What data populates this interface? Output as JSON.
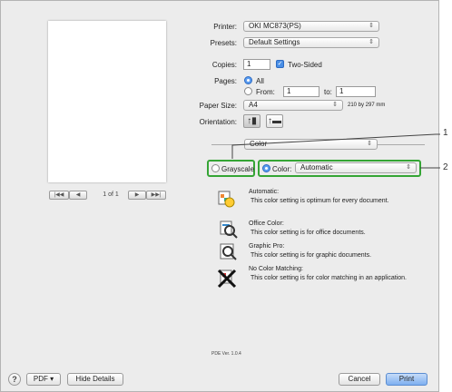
{
  "printer": {
    "label": "Printer:",
    "value": "OKI MC873(PS)"
  },
  "presets": {
    "label": "Presets:",
    "value": "Default Settings"
  },
  "copies": {
    "label": "Copies:",
    "value": "1",
    "two_sided_label": "Two-Sided"
  },
  "pages": {
    "label": "Pages:",
    "all_label": "All",
    "from_label": "From:",
    "from_value": "1",
    "to_label": "to:",
    "to_value": "1"
  },
  "paper_size": {
    "label": "Paper Size:",
    "value": "A4",
    "dimensions": "210 by 297 mm"
  },
  "orientation": {
    "label": "Orientation:"
  },
  "section_popup": {
    "value": "Color"
  },
  "grayscale_label": "Grayscale",
  "color_label": "Color:",
  "color_mode": "Automatic",
  "callouts": [
    "1",
    "2"
  ],
  "descriptions": [
    {
      "title": "Automatic:",
      "body": "This color setting is optimum for every document.",
      "icon": "automatic-color-icon"
    },
    {
      "title": "Office Color:",
      "body": "This color setting is for office documents.",
      "icon": "office-color-icon"
    },
    {
      "title": "Graphic Pro:",
      "body": "This color setting is for graphic documents.",
      "icon": "graphic-pro-icon"
    },
    {
      "title": "No Color Matching:",
      "body": "This color setting is for color matching in an application.",
      "icon": "no-color-matching-icon"
    }
  ],
  "pager": {
    "first": "|◀◀",
    "prev": "◀",
    "page_text": "1 of 1",
    "next": "▶",
    "last": "▶▶|"
  },
  "version": "PDE Ver. 1.0.4",
  "footer": {
    "help": "?",
    "pdf_label": "PDF ▾",
    "hide_details_label": "Hide Details",
    "cancel_label": "Cancel",
    "print_label": "Print"
  },
  "colors": {
    "highlight": "#35a535",
    "primary_button": "#7eaff0"
  }
}
